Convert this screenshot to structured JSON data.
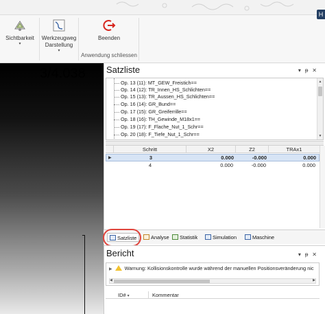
{
  "ribbon": {
    "help_label": "H",
    "buttons": [
      {
        "label": "Sichtbarkeit",
        "icon": "visibility-icon"
      },
      {
        "label": "Werkzeugweg Darstellung",
        "label_line1": "Werkzeugweg",
        "label_line2": "Darstellung",
        "icon": "toolpath-icon"
      },
      {
        "label": "Beenden",
        "icon": "exit-icon"
      }
    ],
    "group_label": "Anwendung schliessen",
    "accent_color": "#d7261e"
  },
  "viewport": {
    "value": "3/4.038"
  },
  "satzliste": {
    "title": "Satzliste",
    "tree_items": [
      "Op. 13 (11): MT_GEW_Freistich==",
      "Op. 14 (12): TR_Innen_HS_Schlichten==",
      "Op. 15 (13): TR_Aussen_HS_Schlichten==",
      "Op. 16 (14): GR_Bund==",
      "Op. 17 (15): GR_Greiferrille==",
      "Op. 18 (16): TH_Gewinde_M18x1==",
      "Op. 19 (17): F_Flache_Nut_1_Schr==",
      "Op. 20 (18): F_Tiefe_Nut_1_Schr=="
    ],
    "columns": [
      "Schritt",
      "X2",
      "Z2",
      "TRAx1"
    ],
    "rows": [
      {
        "schritt": "3",
        "x2": "0.000",
        "z2": "-0.000",
        "trax1": "0.000",
        "selected": true
      },
      {
        "schritt": "4",
        "x2": "0.000",
        "z2": "-0.000",
        "trax1": "0.000",
        "selected": false
      }
    ]
  },
  "tabs": [
    {
      "label": "Satzliste",
      "icon": "list-icon",
      "active": true
    },
    {
      "label": "Analyse",
      "icon": "analysis-icon",
      "active": false
    },
    {
      "label": "Statistik",
      "icon": "statistics-icon",
      "active": false
    },
    {
      "label": "Simulation",
      "icon": "simulation-icon",
      "active": false
    },
    {
      "label": "Maschine",
      "icon": "machine-icon",
      "active": false
    }
  ],
  "bericht": {
    "title": "Bericht",
    "warning_text": "Warnung: Kollisionskontrolle wurde während der manuellen Positionsveränderung nic",
    "columns": [
      "ID#",
      "Kommentar"
    ]
  },
  "panel_controls": [
    "▾",
    "ᵽ",
    "✕"
  ],
  "highlight_color": "#e0443c"
}
